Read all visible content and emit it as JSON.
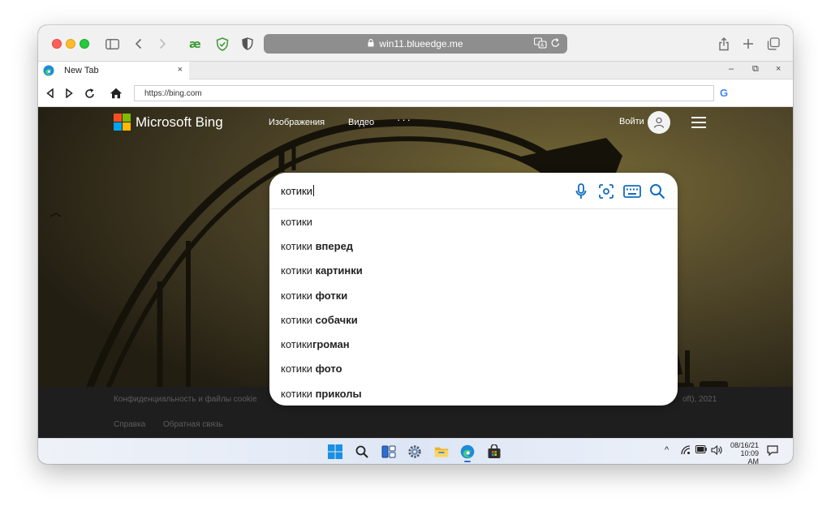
{
  "safari": {
    "url": "win11.blueedge.me"
  },
  "browser": {
    "tab_title": "New Tab",
    "tab_close": "×",
    "win_minimize": "–",
    "win_restore": "⧉",
    "win_close": "×",
    "address": "https://bing.com",
    "search_engine_glyph": "G"
  },
  "bing": {
    "brand": "Microsoft Bing",
    "nav": [
      "Изображения",
      "Видео"
    ],
    "more": "···",
    "signin": "Войти",
    "search": {
      "query": "котики",
      "suggestions": [
        {
          "prefix": "котики",
          "bold": ""
        },
        {
          "prefix": "котики ",
          "bold": "вперед"
        },
        {
          "prefix": "котики ",
          "bold": "картинки"
        },
        {
          "prefix": "котики ",
          "bold": "фотки"
        },
        {
          "prefix": "котики ",
          "bold": "собачки"
        },
        {
          "prefix": "котики",
          "bold": "громан"
        },
        {
          "prefix": "котики ",
          "bold": "фото"
        },
        {
          "prefix": "котики ",
          "bold": "приколы"
        }
      ]
    },
    "footer": {
      "privacy": "Конфиденциальность и файлы cookie",
      "copyright_tail": "oft), 2021",
      "help": "Справка",
      "feedback": "Обратная связь"
    }
  },
  "taskbar": {
    "tray_chevron": "^",
    "time_date": "08/16/21",
    "time_clock": "10:09",
    "time_ampm": "AM"
  },
  "colors": {
    "bing_icon_teal": "#106ebe",
    "url_pill": "#8e8e8e"
  }
}
